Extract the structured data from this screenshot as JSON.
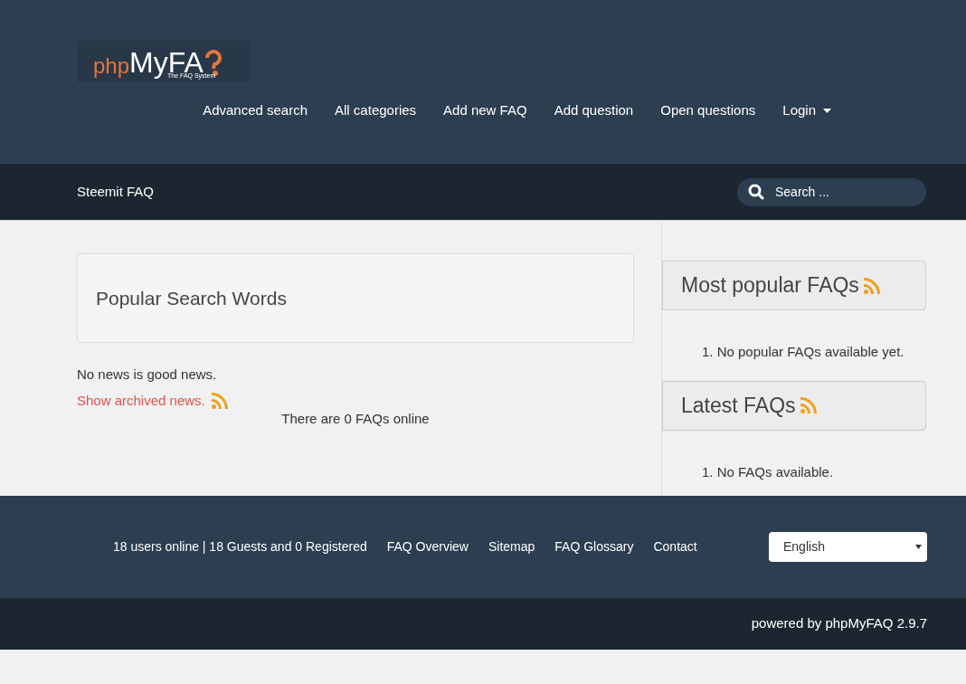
{
  "logo": {
    "prefix": "php",
    "name": "MyFA",
    "tagline": "The FAQ System"
  },
  "nav": [
    {
      "label": "Advanced search"
    },
    {
      "label": "All categories"
    },
    {
      "label": "Add new FAQ"
    },
    {
      "label": "Add question"
    },
    {
      "label": "Open questions"
    },
    {
      "label": "Login",
      "dropdown": true
    }
  ],
  "site_title": "Steemit FAQ",
  "search": {
    "placeholder": "Search ..."
  },
  "main": {
    "panel_title": "Popular Search Words",
    "news": "No news is good news.",
    "archive_link": "Show archived news.",
    "faq_count": "There are 0 FAQs online"
  },
  "sidebar": [
    {
      "title": "Most popular FAQs",
      "items": [
        {
          "number": "1.",
          "text": "No popular FAQs available yet."
        }
      ]
    },
    {
      "title": "Latest FAQs",
      "items": [
        {
          "number": "1.",
          "text": "No FAQs available."
        }
      ]
    }
  ],
  "footer": {
    "online": "18 users online | 18 Guests and 0 Registered",
    "links": [
      "FAQ Overview",
      "Sitemap",
      "FAQ Glossary",
      "Contact"
    ],
    "language": "English"
  },
  "powered_by": "powered by phpMyFAQ 2.9.7"
}
